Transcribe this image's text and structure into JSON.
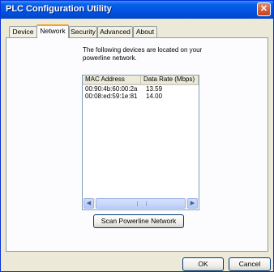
{
  "window": {
    "title": "PLC Configuration Utility",
    "close_glyph": "✕"
  },
  "tabs": [
    {
      "label": "Device"
    },
    {
      "label": "Network"
    },
    {
      "label": "Security"
    },
    {
      "label": "Advanced"
    },
    {
      "label": "About"
    }
  ],
  "active_tab": "Network",
  "network": {
    "intro_line1": "The following devices are located on your",
    "intro_line2": "powerline network.",
    "columns": [
      "MAC Address",
      "Data Rate (Mbps)"
    ],
    "rows": [
      {
        "mac": "00:90:4b:60:00:2a",
        "rate": "13.59"
      },
      {
        "mac": "00:08:ed:59:1e:81",
        "rate": "14.00"
      }
    ],
    "scan_label": "Scan Powerline Network"
  },
  "footer": {
    "ok_label": "OK",
    "cancel_label": "Cancel"
  },
  "icons": {
    "scroll_left": "chevron-left-icon",
    "scroll_right": "chevron-right-icon",
    "close": "close-icon"
  },
  "colors": {
    "titlebar": "#0a62e8",
    "tab_active_accent": "#f7a22d",
    "close_button": "#c4421c"
  }
}
